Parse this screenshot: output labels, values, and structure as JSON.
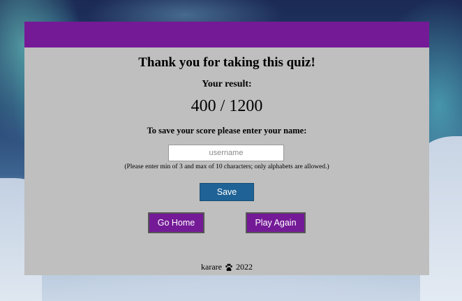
{
  "quiz": {
    "title": "Thank you for taking this quiz!",
    "result_label": "Your result:",
    "score": "400 / 1200",
    "save_prompt": "To save your score please enter your name:",
    "username_placeholder": "username",
    "username_value": "",
    "hint": "(Please enter min of 3 and max of 10 characters; only alphabets are allowed.)",
    "save_label": "Save",
    "home_label": "Go Home",
    "play_again_label": "Play Again"
  },
  "footer": {
    "author": "karare",
    "year": "2022",
    "icon": "paw-icon"
  },
  "colors": {
    "header": "#741a97",
    "card": "#bfbfbf",
    "save_button": "#1f6396",
    "nav_button": "#741a97"
  }
}
